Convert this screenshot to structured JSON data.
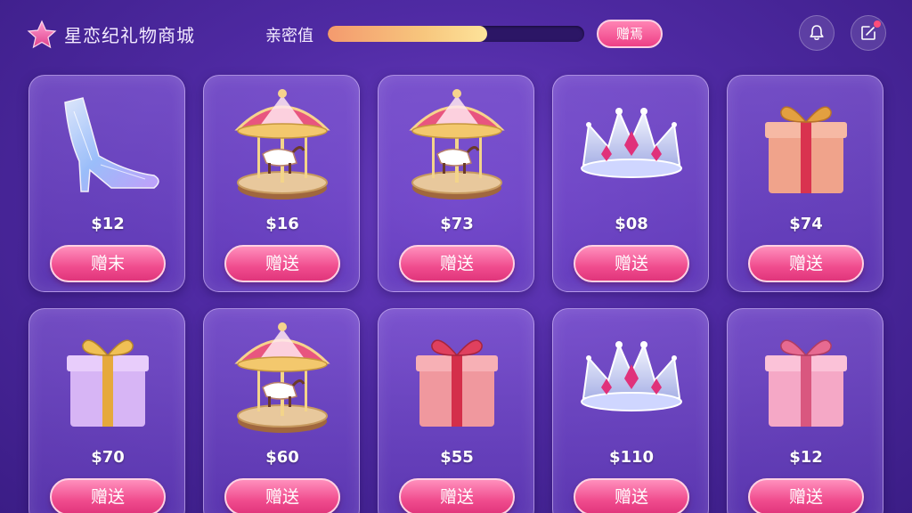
{
  "header": {
    "app_title": "星恋纪礼物商城",
    "intimacy_label": "亲密值",
    "intimacy_progress": 0.62,
    "gift_button_label": "赠焉",
    "bell_icon": "bell-icon",
    "share_icon": "share-icon"
  },
  "gifts": [
    {
      "icon": "glass-slipper",
      "price": "$12",
      "button": "赠末"
    },
    {
      "icon": "carousel",
      "price": "$16",
      "button": "赠送"
    },
    {
      "icon": "carousel",
      "price": "$73",
      "button": "赠送"
    },
    {
      "icon": "crown",
      "price": "$08",
      "button": "赠送"
    },
    {
      "icon": "gift-box-orange",
      "price": "$74",
      "button": "赠送"
    },
    {
      "icon": "gift-box-gold",
      "price": "$70",
      "button": "赠送"
    },
    {
      "icon": "carousel",
      "price": "$60",
      "button": "赠送"
    },
    {
      "icon": "gift-box-red",
      "price": "$55",
      "button": "赠送"
    },
    {
      "icon": "crown",
      "price": "$110",
      "button": "赠送"
    },
    {
      "icon": "gift-box-pink",
      "price": "$12",
      "button": "赠送"
    }
  ],
  "colors": {
    "background": "#4f2aa3",
    "button_pink": "#f04c8e",
    "progress_fill": "#f7c67d"
  }
}
